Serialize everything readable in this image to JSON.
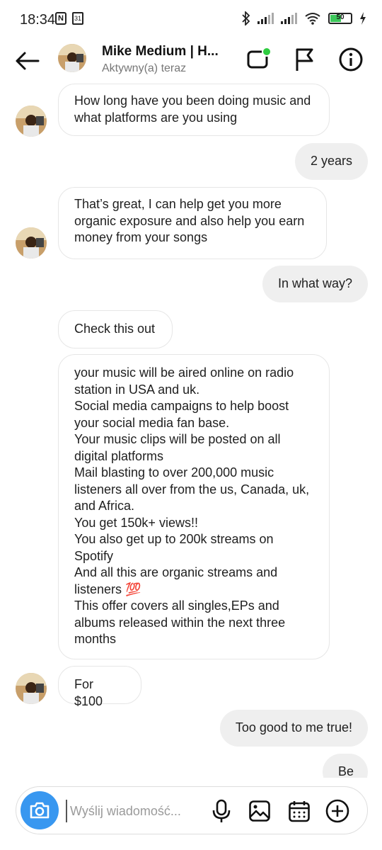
{
  "status_bar": {
    "time": "18:34",
    "battery": "50",
    "calendar_day": "31"
  },
  "header": {
    "name": "Mike Medium | H...",
    "status": "Aktywny(a) teraz",
    "icons": [
      "back-arrow-icon",
      "video-call-icon",
      "flag-icon",
      "info-icon"
    ]
  },
  "messages": [
    {
      "from": "them",
      "lines": [
        "How long have you been doing music and",
        "what platforms are you using"
      ]
    },
    {
      "from": "me",
      "text": "2 years"
    },
    {
      "from": "them",
      "lines": [
        "That’s great, I can help get you more",
        "organic exposure and also help you earn",
        "money from your songs"
      ]
    },
    {
      "from": "me",
      "text": "In what way?"
    },
    {
      "from": "them",
      "lines": [
        "Check this out"
      ]
    },
    {
      "from": "them",
      "lines": [
        "your music will be aired online on radio",
        "station in USA and uk.",
        "Social media campaigns to help boost",
        "your social media fan base.",
        "Your music clips will be posted on all",
        "digital platforms",
        "Mail blasting to over 200,000 music",
        "listeners all over from the us, Canada, uk,",
        "and Africa.",
        "You get 150k+ views!!",
        "You also get up to 200k streams on",
        "Spotify",
        "And all this are organic streams and",
        "listeners 💯",
        "This offer covers all singles,EPs and",
        "albums released within the next three",
        "months"
      ]
    },
    {
      "from": "them",
      "lines": [
        "For $100"
      ]
    },
    {
      "from": "me",
      "text": "Too good to me true!"
    },
    {
      "from": "me",
      "text": "Be"
    }
  ],
  "composer": {
    "placeholder": "Wyślij wiadomość...",
    "icons": [
      "camera-icon",
      "microphone-icon",
      "gallery-icon",
      "sticker-calendar-icon",
      "add-icon"
    ]
  },
  "colors": {
    "camera_button": "#3897f0",
    "outgoing_bubble": "#efefef",
    "online_dot": "#2ecc40",
    "battery_fill": "#3cc85a"
  }
}
